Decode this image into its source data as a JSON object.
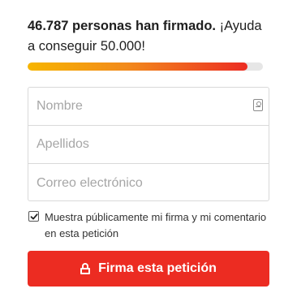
{
  "headline": {
    "count_text": "46.787 personas han firmado.",
    "cta_text": " ¡Ayuda a conseguir 50.000!"
  },
  "progress": {
    "signed": 46787,
    "goal": 50000,
    "fraction": 0.936
  },
  "form": {
    "first_name_placeholder": "Nombre",
    "last_name_placeholder": "Apellidos",
    "email_placeholder": "Correo electrónico"
  },
  "consent": {
    "checked": true,
    "label": "Muestra públicamente mi firma y mi comentario en esta petición"
  },
  "submit": {
    "label": "Firma esta petición"
  },
  "colors": {
    "accent": "#ec2c22",
    "progress_start": "#f7b500",
    "progress_end": "#ec2c22"
  },
  "icons": {
    "field_icon": "contact-card-icon",
    "button_icon": "lock-icon",
    "checkbox_icon": "checkmark-icon"
  }
}
